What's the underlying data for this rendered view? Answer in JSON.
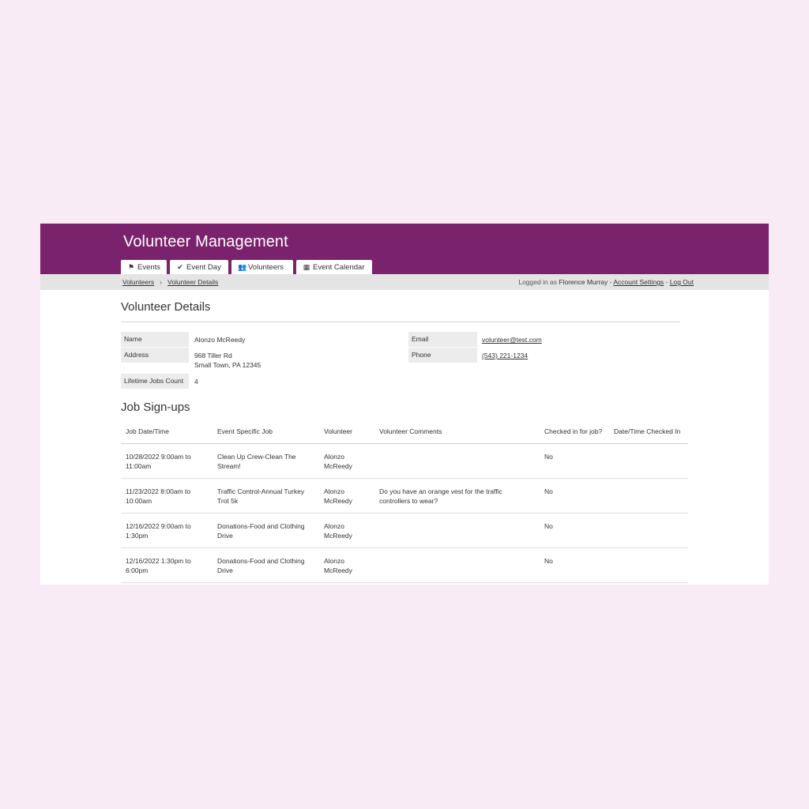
{
  "app": {
    "title": "Volunteer Management"
  },
  "tabs": [
    {
      "label": "Events",
      "icon": "flag-icon"
    },
    {
      "label": "Event Day",
      "icon": "check-icon"
    },
    {
      "label": "Volunteers",
      "icon": "users-icon"
    },
    {
      "label": "Event Calendar",
      "icon": "calendar-icon"
    }
  ],
  "breadcrumb": {
    "items": [
      "Volunteers",
      "Volunteer Details"
    ]
  },
  "user": {
    "prefix": "Logged in as",
    "name": "Florence Murray",
    "account_settings": "Account Settings",
    "log_out": "Log Out"
  },
  "details": {
    "title": "Volunteer Details",
    "name_label": "Name",
    "name_value": "Alonzo McReedy",
    "address_label": "Address",
    "address_line1": "968 Tiller Rd",
    "address_line2": "Small Town, PA 12345",
    "jobs_count_label": "Lifetime Jobs Count",
    "jobs_count_value": "4",
    "email_label": "Email",
    "email_value": "volunteer@test.com",
    "phone_label": "Phone",
    "phone_value": "(543) 221-1234"
  },
  "jobs": {
    "title": "Job Sign-ups",
    "columns": [
      "Job Date/Time",
      "Event Specific Job",
      "Volunteer",
      "Volunteer Comments",
      "Checked in for job?",
      "Date/Time Checked In"
    ],
    "rows": [
      {
        "datetime_1": "10/28/2022 9:00am to",
        "datetime_2": "11:00am",
        "job_1": "Clean Up Crew-Clean The",
        "job_2": "Stream!",
        "vol_1": "Alonzo",
        "vol_2": "McReedy",
        "comment_1": "",
        "comment_2": "",
        "checked": "No",
        "checked_at": ""
      },
      {
        "datetime_1": "11/23/2022 8:00am to",
        "datetime_2": "10:00am",
        "job_1": "Traffic Control-Annual Turkey",
        "job_2": "Trot 5k",
        "vol_1": "Alonzo",
        "vol_2": "McReedy",
        "comment_1": "Do you have an orange vest for the traffic",
        "comment_2": "controllers to wear?",
        "checked": "No",
        "checked_at": ""
      },
      {
        "datetime_1": "12/16/2022 9:00am to",
        "datetime_2": "1:30pm",
        "job_1": "Donations-Food and Clothing",
        "job_2": "Drive",
        "vol_1": "Alonzo",
        "vol_2": "McReedy",
        "comment_1": "",
        "comment_2": "",
        "checked": "No",
        "checked_at": ""
      },
      {
        "datetime_1": "12/16/2022 1:30pm to",
        "datetime_2": "6:00pm",
        "job_1": "Donations-Food and Clothing",
        "job_2": "Drive",
        "vol_1": "Alonzo",
        "vol_2": "McReedy",
        "comment_1": "",
        "comment_2": "",
        "checked": "No",
        "checked_at": ""
      }
    ]
  },
  "colors": {
    "brand": "#7a226b",
    "page_background": "#f9ebf6",
    "subbar": "#e4e4e4"
  }
}
